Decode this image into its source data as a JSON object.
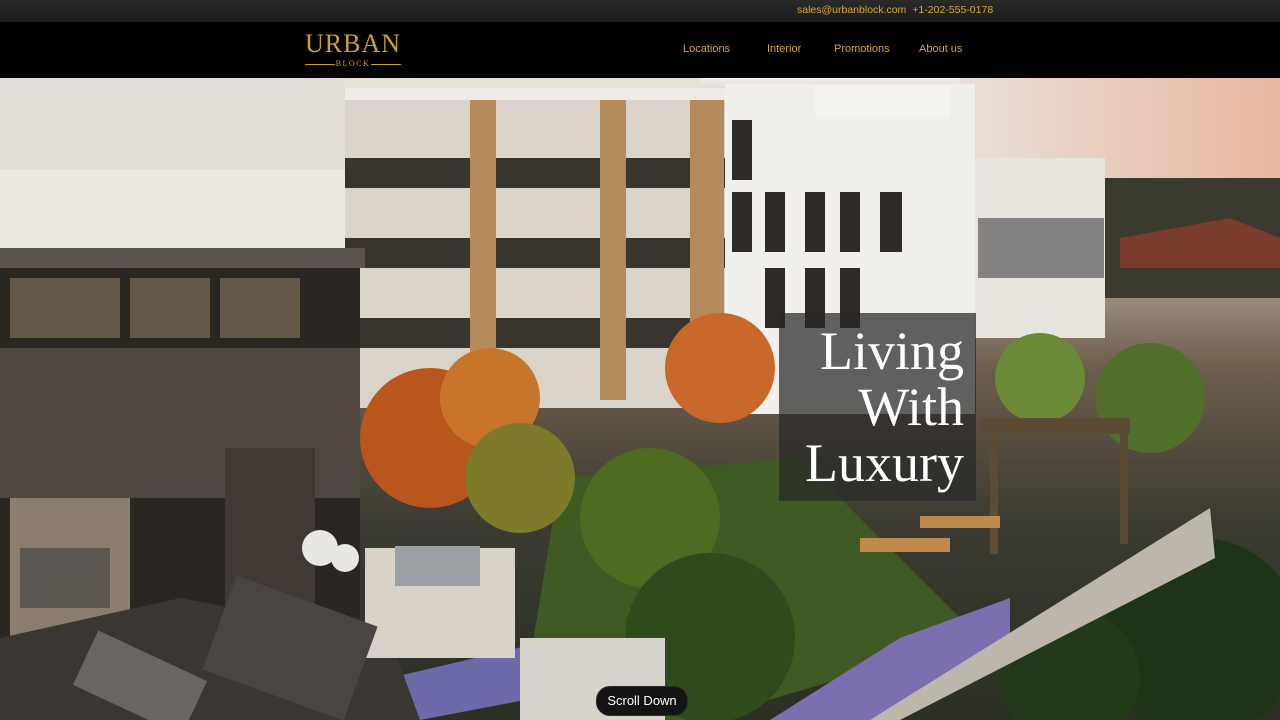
{
  "topbar": {
    "email": "sales@urbanblock.com",
    "phone": "+1-202-555-0178"
  },
  "brand": {
    "name": "URBAN",
    "subname": "BLOCK",
    "color": "#c9a233"
  },
  "nav": {
    "items": [
      {
        "label": "Locations"
      },
      {
        "label": "Interior"
      },
      {
        "label": "Promotions"
      },
      {
        "label": "About us"
      }
    ]
  },
  "hero": {
    "headline_lines": [
      "Living",
      "With",
      "Luxury"
    ],
    "scroll_label": "Scroll Down",
    "image_description": "hero-photo-apartment-courtyard"
  }
}
